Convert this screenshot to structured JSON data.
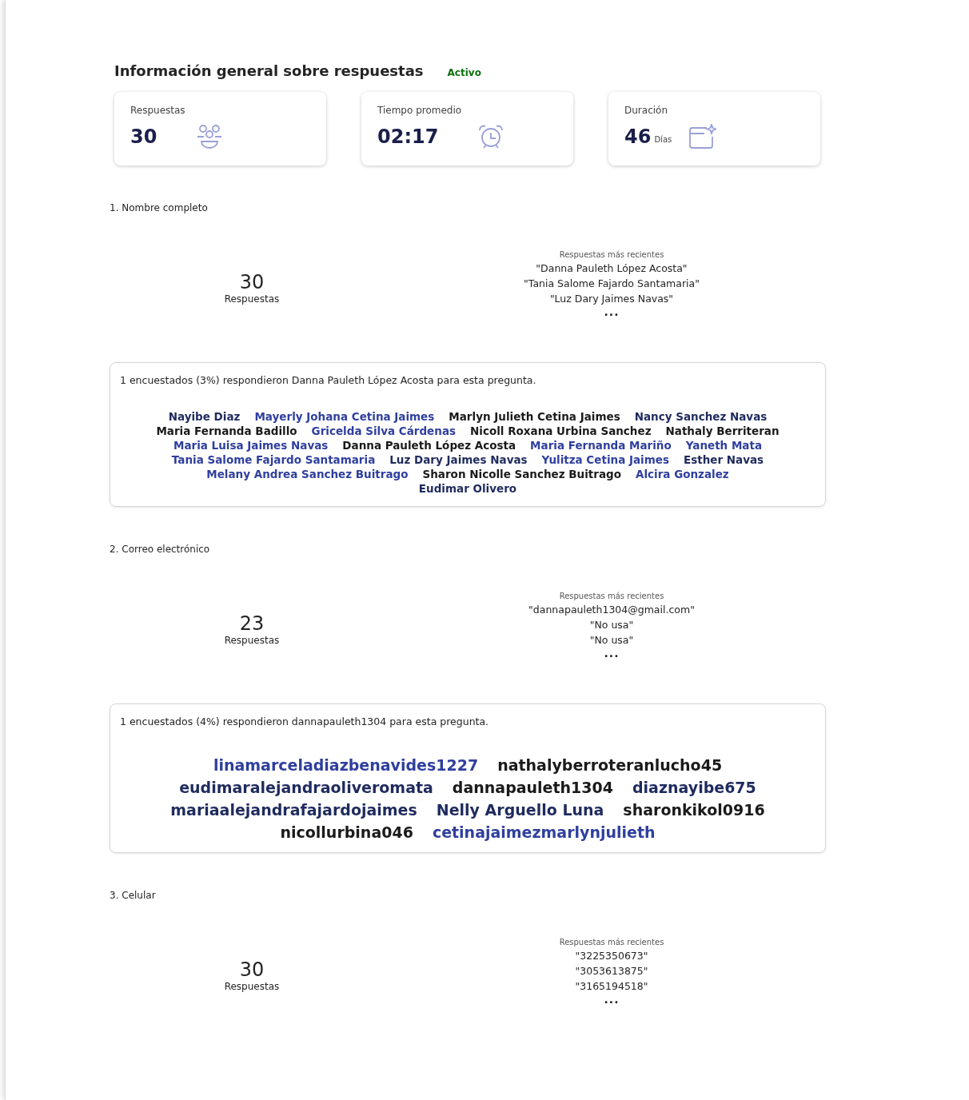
{
  "header": {
    "title": "Información general sobre respuestas",
    "status": "Activo"
  },
  "stats": [
    {
      "kind": "responses",
      "label": "Respuestas",
      "value": "30"
    },
    {
      "kind": "time",
      "label": "Tiempo promedio",
      "value": "02:17"
    },
    {
      "kind": "duration",
      "label": "Duración",
      "value": "46",
      "unit": "Días"
    }
  ],
  "questions": [
    {
      "title": "1. Nombre completo",
      "count": "30",
      "count_label": "Respuestas",
      "recent_label": "Respuestas más recientes",
      "recent": [
        "\"Danna Pauleth López Acosta\"",
        "\"Tania Salome Fajardo Santamaria\"",
        "\"Luz Dary Jaimes Navas\""
      ],
      "more": "...",
      "cloud": {
        "kind": "small",
        "summary": "1 encuestados (3%) respondieron Danna Pauleth López Acosta para esta pregunta.",
        "words": [
          {
            "text": "Nayibe Diaz",
            "color": "#1f2b5e"
          },
          {
            "text": "Mayerly Johana Cetina Jaimes",
            "color": "#2f3f9e"
          },
          {
            "text": "Marlyn Julieth Cetina Jaimes",
            "color": "#1a1a1a"
          },
          {
            "text": "Nancy Sanchez Navas",
            "color": "#1f2b5e"
          },
          {
            "text": "Maria Fernanda Badillo",
            "color": "#1a1a1a"
          },
          {
            "text": "Gricelda Silva Cárdenas",
            "color": "#2f3f9e"
          },
          {
            "text": "Nicoll Roxana Urbina Sanchez",
            "color": "#1a1a1a"
          },
          {
            "text": "Nathaly Berriteran",
            "color": "#1a1a1a"
          },
          {
            "text": "Maria Luisa Jaimes Navas",
            "color": "#2f3f9e"
          },
          {
            "text": "Danna Pauleth López Acosta",
            "color": "#1a1a1a"
          },
          {
            "text": "Maria Fernanda Mariño",
            "color": "#2f3f9e"
          },
          {
            "text": "Yaneth Mata",
            "color": "#2f3f9e"
          },
          {
            "text": "Tania Salome Fajardo Santamaria",
            "color": "#2f3f9e"
          },
          {
            "text": "Luz Dary Jaimes Navas",
            "color": "#1f2b5e"
          },
          {
            "text": "Yulitza Cetina Jaimes",
            "color": "#2f3f9e"
          },
          {
            "text": "Esther Navas",
            "color": "#1f2b5e"
          },
          {
            "text": "Melany Andrea Sanchez Buitrago",
            "color": "#2f3f9e"
          },
          {
            "text": "Sharon Nicolle Sanchez Buitrago",
            "color": "#1a1a1a"
          },
          {
            "text": "Alcira Gonzalez",
            "color": "#2f3f9e"
          },
          {
            "text": "Eudimar Olivero",
            "color": "#1f2b5e"
          }
        ]
      }
    },
    {
      "title": "2. Correo electrónico",
      "count": "23",
      "count_label": "Respuestas",
      "recent_label": "Respuestas más recientes",
      "recent": [
        "\"dannapauleth1304@gmail.com\"",
        "\"No usa\"",
        "\"No usa\""
      ],
      "more": "...",
      "cloud": {
        "kind": "large",
        "summary": "1 encuestados (4%) respondieron dannapauleth1304 para esta pregunta.",
        "words": [
          {
            "text": "linamarceladiazbenavides1227",
            "color": "#2f3f9e"
          },
          {
            "text": "nathalyberroteranlucho45",
            "color": "#1a1a1a"
          },
          {
            "text": "eudimaralejandraoliveromata",
            "color": "#1f2b5e"
          },
          {
            "text": "dannapauleth1304",
            "color": "#1a1a1a"
          },
          {
            "text": "diaznayibe675",
            "color": "#1f2b5e"
          },
          {
            "text": "mariaalejandrafajardojaimes",
            "color": "#1f2b5e"
          },
          {
            "text": "Nelly Arguello Luna",
            "color": "#1f2b5e"
          },
          {
            "text": "sharonkikol0916",
            "color": "#1a1a1a"
          },
          {
            "text": "nicollurbina046",
            "color": "#1a1a1a"
          },
          {
            "text": "cetinajaimezmarlynjulieth",
            "color": "#2f3f9e"
          }
        ]
      }
    },
    {
      "title": "3. Celular",
      "count": "30",
      "count_label": "Respuestas",
      "recent_label": "Respuestas más recientes",
      "recent": [
        "\"3225350673\"",
        "\"3053613875\"",
        "\"3165194518\""
      ],
      "more": "..."
    }
  ]
}
